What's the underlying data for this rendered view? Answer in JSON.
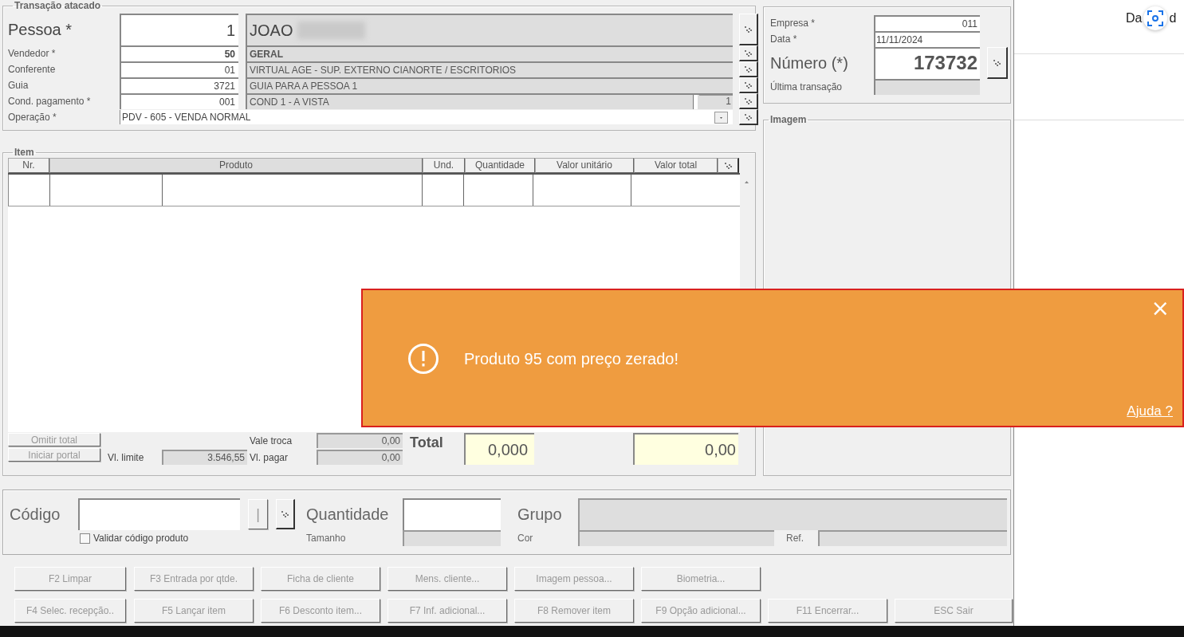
{
  "transaction": {
    "title": "Transação atacado",
    "pessoa": {
      "label": "Pessoa *",
      "code": "1",
      "name": "JOAO",
      "name_redacted": true
    },
    "rows": [
      {
        "label": "Vendedor *",
        "code": "50",
        "description": "GERAL",
        "emphasized": true
      },
      {
        "label": "Conferente",
        "code": "01",
        "description": "VIRTUAL AGE - SUP. EXTERNO CIANORTE / ESCRITORIOS",
        "emphasized": false
      },
      {
        "label": "Guia",
        "code": "3721",
        "description": "GUIA PARA A PESSOA 1",
        "emphasized": false
      },
      {
        "label": "Cond. pagamento *",
        "code": "001",
        "description": "COND 1 - A VISTA",
        "counter": "1",
        "emphasized": false
      }
    ],
    "operacao": {
      "label": "Operação *",
      "value": "PDV - 605 - VENDA NORMAL"
    }
  },
  "header": {
    "fields": [
      {
        "label": "Empresa *",
        "value": "011",
        "kind": "small"
      },
      {
        "label": "Data *",
        "value": "11/11/2024",
        "kind": "date"
      },
      {
        "label": "Número (*)",
        "value": "173732",
        "kind": "large"
      },
      {
        "label": "Última transação",
        "kind": "readonly"
      }
    ]
  },
  "image_panel": {
    "title": "Imagem"
  },
  "items": {
    "title": "Item",
    "columns": [
      "Nr.",
      "Produto",
      "Und.",
      "Quantidade",
      "Valor unitário",
      "Valor total"
    ],
    "omitir_total": {
      "label": "Omitir total",
      "disabled": true
    },
    "iniciar_portal": {
      "label": "Iniciar portal",
      "disabled": true
    },
    "vl_limite": {
      "label": "Vl. limite",
      "value": "3.546,55"
    },
    "vale_troca": {
      "label": "Vale troca",
      "value": "0,00"
    },
    "vl_pagar": {
      "label": "Vl. pagar",
      "value": "0,00"
    },
    "total": {
      "label": "Total",
      "quantity": "0,000",
      "value": "0,00"
    }
  },
  "entry": {
    "codigo": "Código",
    "validar": {
      "label": "Validar código produto",
      "checked": false
    },
    "cursor_button": "|",
    "quantidade": "Quantidade",
    "tamanho": "Tamanho",
    "grupo": "Grupo",
    "cor": "Cor",
    "ref": "Ref."
  },
  "buttons": [
    [
      {
        "label": "F2 Limpar",
        "disabled": true
      },
      {
        "label": "F3 Entrada por qtde.",
        "disabled": true
      },
      {
        "label": "Ficha de cliente",
        "disabled": true
      },
      {
        "label": "Mens. cliente...",
        "disabled": true
      },
      {
        "label": "Imagem pessoa...",
        "disabled": true
      },
      {
        "label": "Biometria...",
        "disabled": true
      }
    ],
    [
      {
        "label": "F4 Selec. recepção..",
        "disabled": true
      },
      {
        "label": "F5 Lançar item",
        "disabled": true
      },
      {
        "label": "F6 Desconto item...",
        "disabled": true
      },
      {
        "label": "F7 Inf. adicional...",
        "disabled": true
      },
      {
        "label": "F8 Remover item",
        "disabled": true
      },
      {
        "label": "F9 Opção adicional...",
        "disabled": true
      },
      {
        "label": "F11 Encerrar...",
        "disabled": true
      },
      {
        "label": "ESC Sair",
        "disabled": true
      }
    ]
  ],
  "background_page": {
    "heading_start": "Da",
    "heading_end": "d"
  },
  "toast": {
    "message": "Produto 95 com preço zerado!",
    "close": "×",
    "help_link": "Ajuda ?"
  }
}
